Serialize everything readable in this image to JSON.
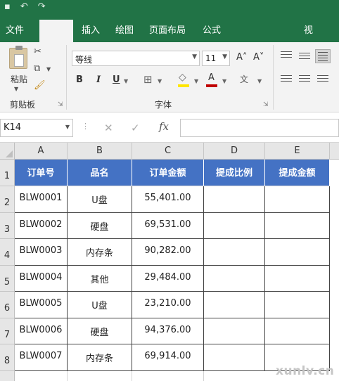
{
  "ribbon_tabs": [
    "文件",
    "插入",
    "绘图",
    "页面布局",
    "公式",
    "视"
  ],
  "clipboard": {
    "paste_label": "粘贴",
    "group_label": "剪贴板"
  },
  "font": {
    "font_name": "等线",
    "font_size": "11",
    "grow_icon": "A˄",
    "shrink_icon": "A˅",
    "bold": "B",
    "italic": "I",
    "underline": "U",
    "group_label": "字体"
  },
  "formula_bar": {
    "name_box": "K14",
    "cancel_icon": "✕",
    "enter_icon": "✓",
    "fx_icon": "fx",
    "formula": ""
  },
  "sheet": {
    "columns": [
      "A",
      "B",
      "C",
      "D",
      "E"
    ],
    "row_numbers": [
      "1",
      "2",
      "3",
      "4",
      "5",
      "6",
      "7",
      "8"
    ],
    "header": [
      "订单号",
      "品名",
      "订单金额",
      "提成比例",
      "提成金额"
    ],
    "rows": [
      [
        "BLW0001",
        "U盘",
        "55,401.00",
        "",
        ""
      ],
      [
        "BLW0002",
        "硬盘",
        "69,531.00",
        "",
        ""
      ],
      [
        "BLW0003",
        "内存条",
        "90,282.00",
        "",
        ""
      ],
      [
        "BLW0004",
        "其他",
        "29,484.00",
        "",
        ""
      ],
      [
        "BLW0005",
        "U盘",
        "23,210.00",
        "",
        ""
      ],
      [
        "BLW0006",
        "硬盘",
        "94,376.00",
        "",
        ""
      ],
      [
        "BLW0007",
        "内存条",
        "69,914.00",
        "",
        ""
      ]
    ]
  },
  "watermark": "xunlv.cn",
  "colors": {
    "ribbon_green": "#217346",
    "table_header_blue": "#4472c4",
    "font_color_red": "#c00000",
    "fill_color_yellow": "#ffe600"
  },
  "icons": [
    "cut-icon",
    "copy-icon",
    "format-painter-icon",
    "borders-icon",
    "fill-color-icon",
    "font-color-icon",
    "phonetic-icon",
    "align-top-icon",
    "align-middle-icon",
    "align-bottom-icon",
    "align-left-icon",
    "align-center-icon",
    "align-right-icon"
  ]
}
